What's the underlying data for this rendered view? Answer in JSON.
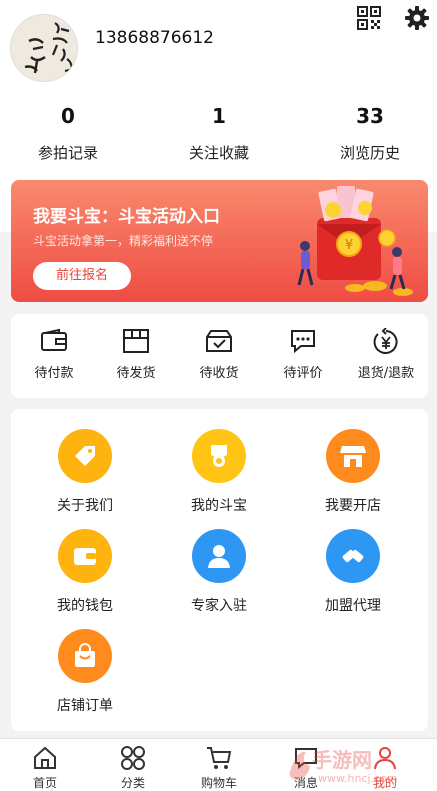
{
  "profile": {
    "phone": "13868876612"
  },
  "stats": [
    {
      "value": "0",
      "label": "参拍记录"
    },
    {
      "value": "1",
      "label": "关注收藏"
    },
    {
      "value": "33",
      "label": "浏览历史"
    }
  ],
  "banner": {
    "title": "我要斗宝：斗宝活动入口",
    "subtitle": "斗宝活动拿第一，精彩福利送不停",
    "button": "前往报名"
  },
  "orders": [
    {
      "label": "待付款",
      "icon": "wallet-icon"
    },
    {
      "label": "待发货",
      "icon": "box-icon"
    },
    {
      "label": "待收货",
      "icon": "inbox-check-icon"
    },
    {
      "label": "待评价",
      "icon": "chat-dots-icon"
    },
    {
      "label": "退货/退款",
      "icon": "refund-yen-icon"
    }
  ],
  "services": [
    {
      "label": "关于我们",
      "icon": "tag-icon",
      "color": "#ffb30f"
    },
    {
      "label": "我的斗宝",
      "icon": "medal-icon",
      "color": "#ffc414"
    },
    {
      "label": "我要开店",
      "icon": "store-icon",
      "color": "#ff8a1e"
    },
    {
      "label": "我的钱包",
      "icon": "wallet-icon",
      "color": "#ffb30f"
    },
    {
      "label": "专家入驻",
      "icon": "person-icon",
      "color": "#2d97f3"
    },
    {
      "label": "加盟代理",
      "icon": "handshake-icon",
      "color": "#2d97f3"
    },
    {
      "label": "店铺订单",
      "icon": "shopping-bag-icon",
      "color": "#ff8a1e"
    }
  ],
  "tabbar": [
    {
      "label": "首页",
      "icon": "home-icon"
    },
    {
      "label": "分类",
      "icon": "category-icon"
    },
    {
      "label": "购物车",
      "icon": "cart-icon"
    },
    {
      "label": "消息",
      "icon": "message-icon"
    },
    {
      "label": "我的",
      "icon": "user-icon",
      "active": true
    }
  ],
  "watermark": {
    "text": "手游网",
    "url": "www.hncj.com"
  }
}
